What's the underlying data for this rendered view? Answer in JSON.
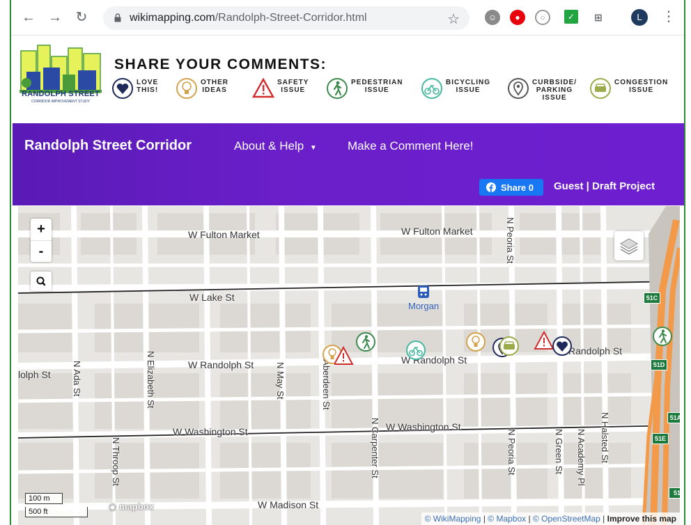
{
  "browser": {
    "url_domain": "wikimapping.com",
    "url_path": "/Randolph-Street-Corridor.html",
    "avatar_letter": "L"
  },
  "banner": {
    "logo_title": "RANDOLPH STREET",
    "logo_subtitle": "CORRIDOR IMPROVEMENT STUDY",
    "share_title": "SHARE YOUR COMMENTS:",
    "categories": [
      {
        "label": "LOVE\nTHIS!",
        "icon": "heart-icon",
        "color": "#1f2a5a"
      },
      {
        "label": "OTHER\nIDEAS",
        "icon": "lightbulb-icon",
        "color": "#d4a24c"
      },
      {
        "label": "SAFETY\nISSUE",
        "icon": "warning-icon",
        "color": "#d22b2b"
      },
      {
        "label": "PEDESTRIAN\nISSUE",
        "icon": "pedestrian-icon",
        "color": "#3c8a4c"
      },
      {
        "label": "BICYCLING\nISSUE",
        "icon": "bicycle-icon",
        "color": "#46b7a0"
      },
      {
        "label": "CURBSIDE/\nPARKING\nISSUE",
        "icon": "location-pin-icon",
        "color": "#555555"
      },
      {
        "label": "CONGESTION\nISSUE",
        "icon": "car-icon",
        "color": "#9bab4a"
      }
    ]
  },
  "header": {
    "brand": "Randolph Street Corridor",
    "menu_about": "About & Help",
    "menu_comment": "Make a Comment Here!",
    "share_label": "Share 0",
    "user_status": "Guest | Draft Project",
    "color": "#6a1fc9"
  },
  "map": {
    "zoom_in": "+",
    "zoom_out": "-",
    "streets": {
      "fulton_left": "W Fulton Market",
      "fulton_right": "W Fulton Market",
      "lake": "W Lake St",
      "randolph_mid": "W Randolph St",
      "randolph_east": "W Randolph St",
      "randolph_far_east": "Randolph St",
      "randolph_west": "lolph St",
      "washington_left": "W Washington St",
      "washington_right": "W Washington St",
      "madison": "W Madison St",
      "ada": "N Ada St",
      "elizabeth": "N Elizabeth St",
      "may": "N May St",
      "aberdeen": "N Aberdeen St",
      "carpenter": "N Carpenter St",
      "peoria_top": "N Peoria St",
      "peoria_bottom": "N Peoria St",
      "green": "N Green St",
      "academy": "N Academy Pl",
      "halsted": "N Halsted St",
      "throop": "N Throop St"
    },
    "station": "Morgan",
    "shields": [
      "51C",
      "51D",
      "51A",
      "51E",
      "51"
    ],
    "scale_metric": "100 m",
    "scale_imperial": "500 ft",
    "mapbox_logo": "mapbox",
    "attribution": {
      "wikimapping": "© WikiMapping",
      "mapbox": "© Mapbox",
      "osm": "© OpenStreetMap",
      "improve": "Improve this map"
    }
  }
}
